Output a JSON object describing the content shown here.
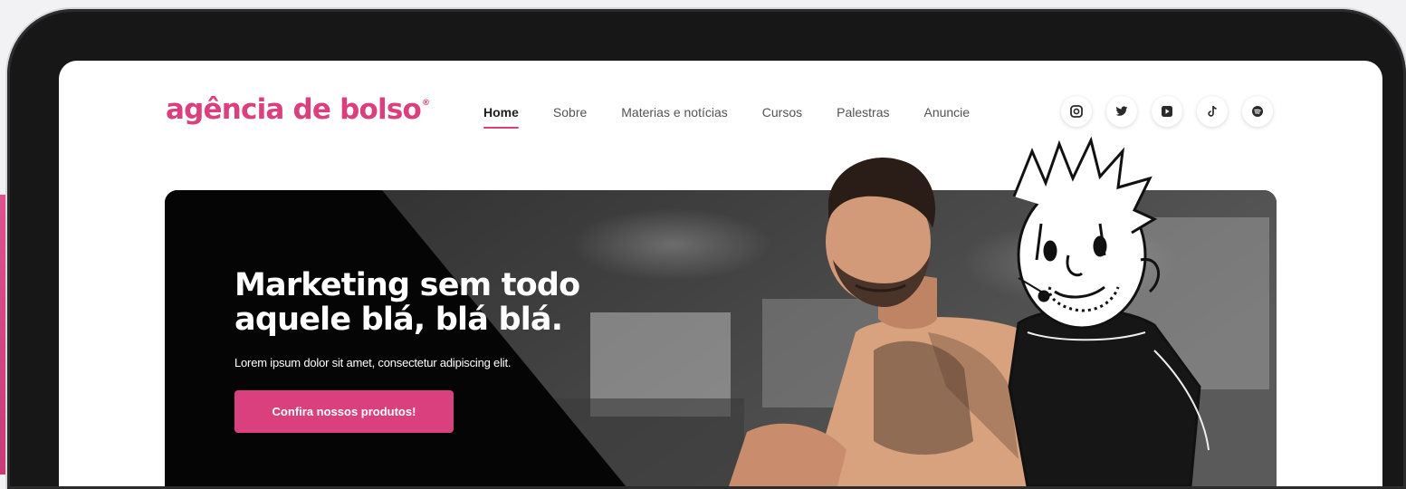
{
  "brand": {
    "logo_text": "agência de bolso",
    "accent_color": "#d9407d"
  },
  "nav": {
    "items": [
      {
        "label": "Home",
        "active": true
      },
      {
        "label": "Sobre",
        "active": false
      },
      {
        "label": "Materias e notícias",
        "active": false
      },
      {
        "label": "Cursos",
        "active": false
      },
      {
        "label": "Palestras",
        "active": false
      },
      {
        "label": "Anuncie",
        "active": false
      }
    ]
  },
  "socials": [
    {
      "icon": "instagram-icon"
    },
    {
      "icon": "twitter-icon"
    },
    {
      "icon": "youtube-icon"
    },
    {
      "icon": "tiktok-icon"
    },
    {
      "icon": "spotify-icon"
    }
  ],
  "hero": {
    "title_line1": "Marketing sem todo",
    "title_line2": "aquele blá, blá blá.",
    "subtitle": "Lorem ipsum dolor sit amet, consectetur adipiscing elit.",
    "cta_label": "Confira nossos produtos!"
  }
}
